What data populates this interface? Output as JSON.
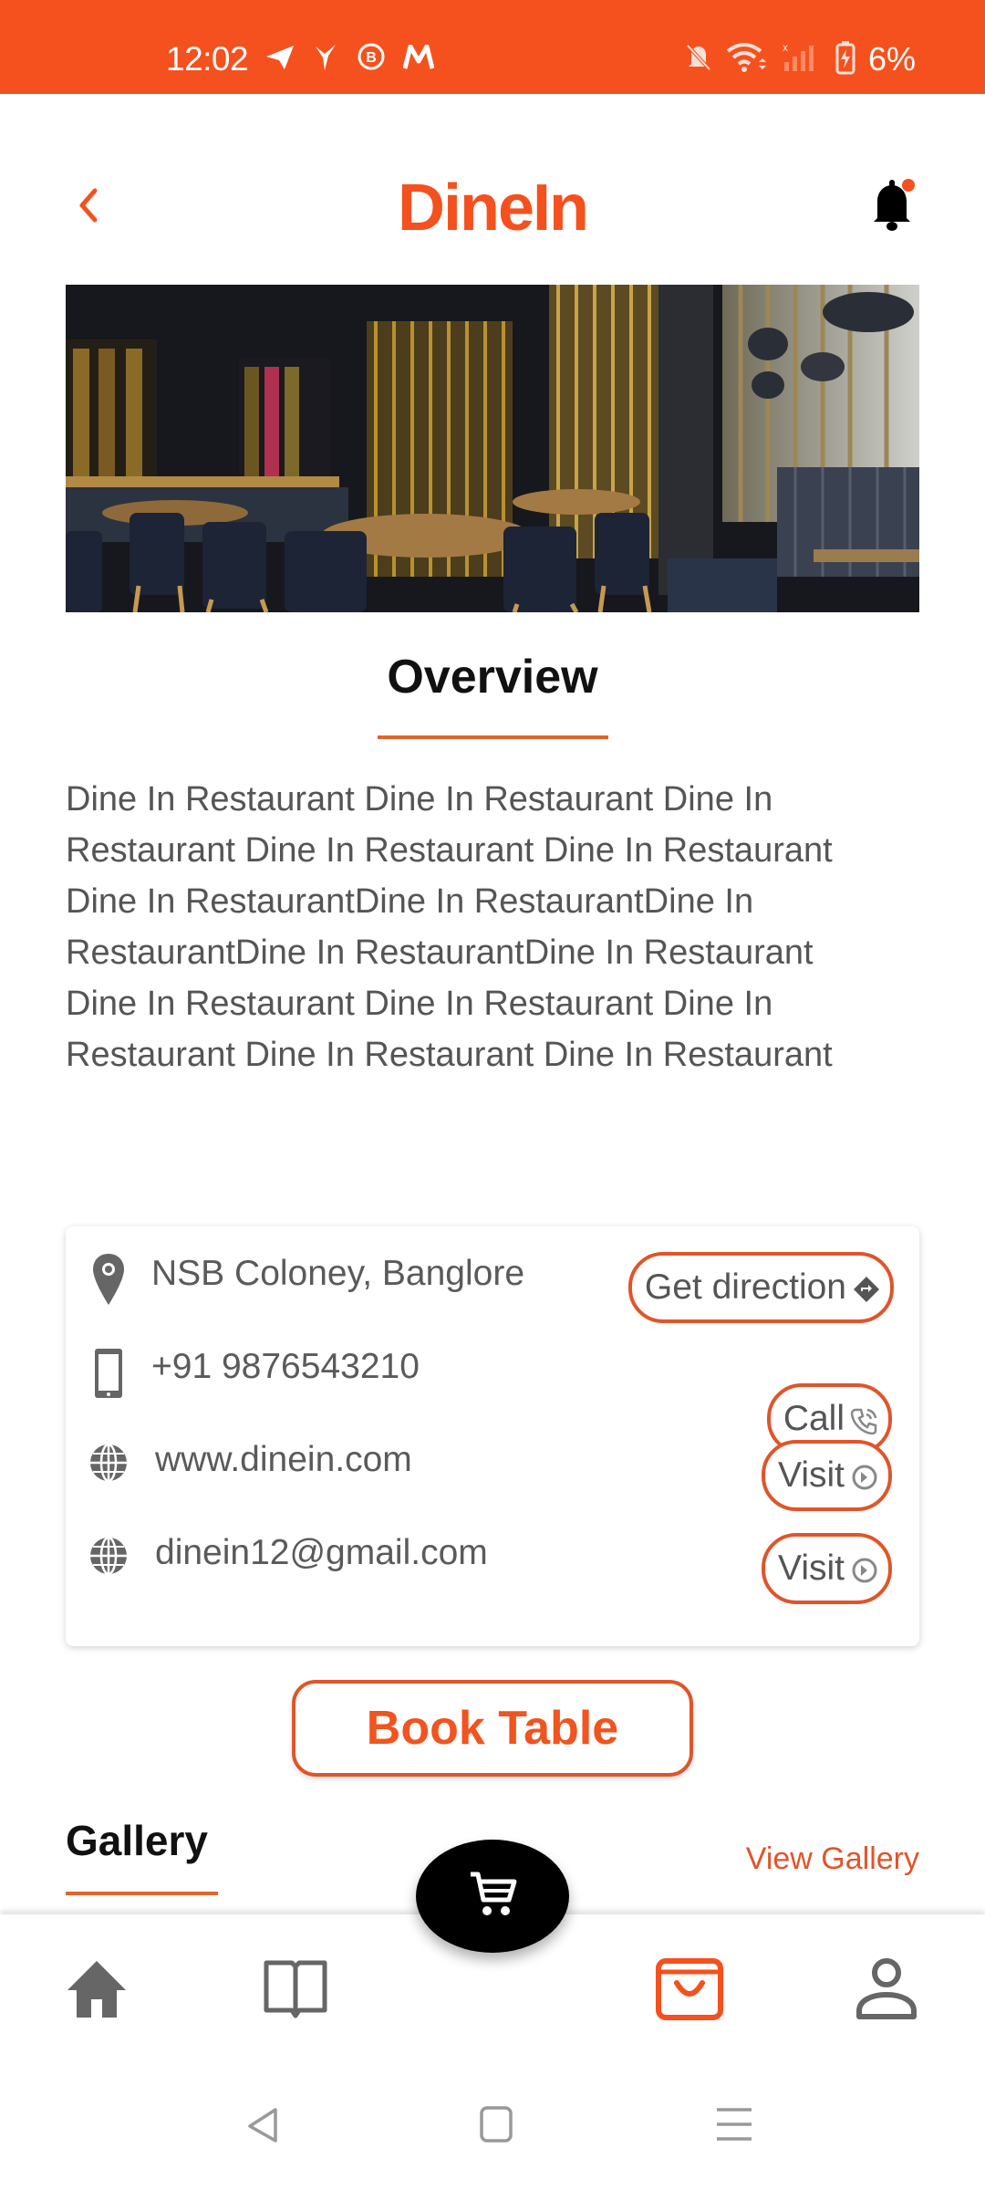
{
  "status_bar": {
    "time": "12:02",
    "notification_icons": [
      "telegram-icon",
      "bird-app-icon",
      "b-chat-icon",
      "m-app-icon"
    ],
    "system_icons": [
      "bell-muted-icon",
      "wifi-icon",
      "signal-no-service-icon",
      "battery-charging-icon"
    ],
    "battery": "6%"
  },
  "header": {
    "back_icon": "chevron-left-icon",
    "app_name": "DineIn",
    "notification_icon": "bell-icon",
    "has_unread_notification": true
  },
  "hero": {
    "alt": "Restaurant interior with tables and chairs"
  },
  "overview": {
    "title": "Overview",
    "description": "Dine In Restaurant Dine In Restaurant Dine In Restaurant Dine In Restaurant Dine In Restaurant Dine In RestaurantDine In RestaurantDine In RestaurantDine In RestaurantDine In Restaurant Dine In Restaurant Dine In Restaurant Dine In Restaurant Dine In Restaurant Dine In Restaurant"
  },
  "contact": {
    "address": {
      "icon": "map-pin-icon",
      "text": "NSB Coloney, Banglore",
      "button": "Get direction",
      "button_icon": "directions-icon"
    },
    "phone": {
      "icon": "smartphone-icon",
      "text": "+91 9876543210",
      "button": "Call",
      "button_icon": "phone-icon"
    },
    "website": {
      "icon": "globe-icon",
      "text": "www.dinein.com",
      "button": "Visit",
      "button_icon": "arrow-circle-right-icon"
    },
    "email": {
      "icon": "globe-icon",
      "text": "dinein12@gmail.com",
      "button": "Visit",
      "button_icon": "arrow-circle-right-icon"
    }
  },
  "book_table": {
    "label": "Book Table"
  },
  "gallery": {
    "title": "Gallery",
    "view_all": "View Gallery"
  },
  "bottom_nav": {
    "items": [
      {
        "name": "home",
        "icon": "home-icon",
        "active": false
      },
      {
        "name": "menu",
        "icon": "book-open-icon",
        "active": false
      },
      {
        "name": "cart",
        "icon": "cart-icon",
        "active": false
      },
      {
        "name": "orders",
        "icon": "shopping-bag-icon",
        "active": true
      },
      {
        "name": "profile",
        "icon": "user-icon",
        "active": false
      }
    ]
  },
  "system_nav": {
    "buttons": [
      "back",
      "home",
      "recents"
    ]
  },
  "colors": {
    "brand": "#f4511e",
    "accent_border": "#e0552a",
    "underline": "#e0642e",
    "icon_gray": "#666666",
    "text_gray": "#555555",
    "fab": "#000000"
  }
}
